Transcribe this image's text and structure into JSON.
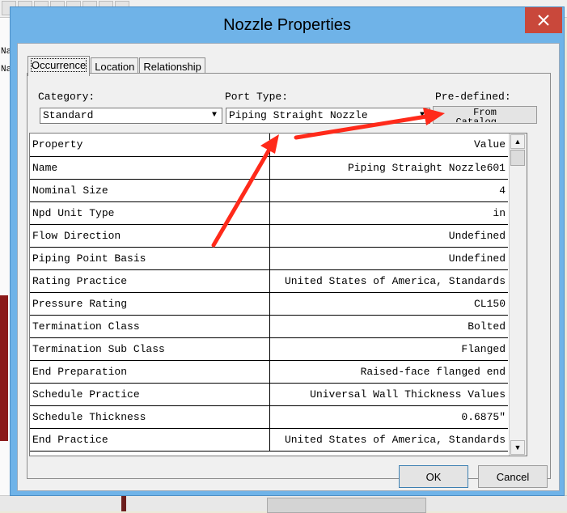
{
  "background": {
    "left_frag_1": "Na",
    "left_frag_2": "Na"
  },
  "dialog": {
    "title": "Nozzle Properties",
    "close_glyph": "✕"
  },
  "tabs": [
    {
      "label": "Occurrence",
      "active": true
    },
    {
      "label": "Location",
      "active": false
    },
    {
      "label": "Relationship",
      "active": false
    }
  ],
  "category": {
    "label": "Category:",
    "value": "Standard"
  },
  "port_type": {
    "label": "Port Type:",
    "value": "Piping Straight Nozzle"
  },
  "predefined": {
    "label": "Pre-defined:",
    "button_line1": "From",
    "button_line2": "Catalog..."
  },
  "grid": {
    "header": {
      "property": "Property",
      "value": "Value"
    },
    "rows": [
      {
        "property": "Name",
        "value": "Piping Straight Nozzle601"
      },
      {
        "property": "Nominal Size",
        "value": "4"
      },
      {
        "property": "Npd Unit Type",
        "value": "in"
      },
      {
        "property": "Flow Direction",
        "value": "Undefined"
      },
      {
        "property": "Piping Point Basis",
        "value": "Undefined"
      },
      {
        "property": "Rating Practice",
        "value": "United States of America, Standards"
      },
      {
        "property": "Pressure Rating",
        "value": "CL150"
      },
      {
        "property": "Termination Class",
        "value": "Bolted"
      },
      {
        "property": "Termination Sub Class",
        "value": "Flanged"
      },
      {
        "property": "End Preparation",
        "value": "Raised-face flanged end"
      },
      {
        "property": "Schedule Practice",
        "value": "Universal Wall Thickness Values"
      },
      {
        "property": "Schedule Thickness",
        "value": "0.6875\""
      },
      {
        "property": "End Practice",
        "value": "United States of America, Standards"
      }
    ]
  },
  "buttons": {
    "ok": "OK",
    "cancel": "Cancel"
  },
  "colors": {
    "annotation_arrow": "#ff2a1a",
    "titlebar": "#6fb3e8",
    "close": "#c9483b"
  }
}
